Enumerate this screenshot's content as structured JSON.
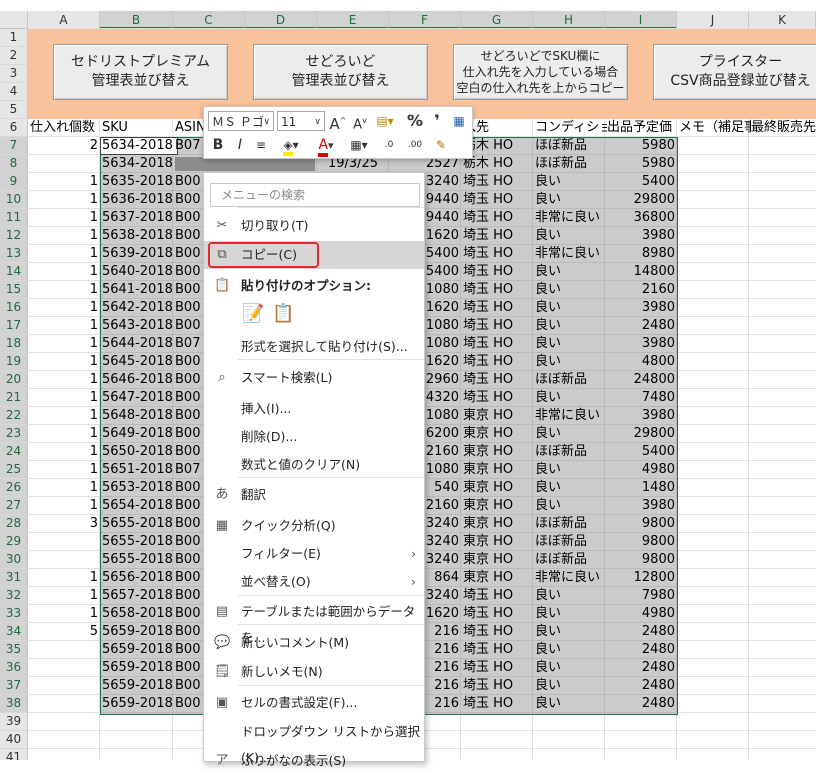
{
  "app": "Microsoft Excel",
  "columns": [
    "A",
    "B",
    "C",
    "D",
    "E",
    "F",
    "G",
    "H",
    "I",
    "J",
    "K"
  ],
  "rows": [
    "1",
    "2",
    "3",
    "4",
    "5",
    "6",
    "7",
    "8",
    "9",
    "10",
    "11",
    "12",
    "13",
    "14",
    "15",
    "16",
    "17",
    "18",
    "19",
    "20",
    "21",
    "22",
    "23",
    "24",
    "25",
    "26",
    "27",
    "28",
    "29",
    "30",
    "31",
    "32",
    "33",
    "34",
    "35",
    "36",
    "37",
    "38",
    "39",
    "40",
    "41"
  ],
  "macro_buttons": [
    {
      "label": "セドリストプレミアム\n管理表並び替え"
    },
    {
      "label": "せどろいど\n管理表並び替え"
    },
    {
      "label": "せどろいどでSKU欄に\n仕入れ先を入力している場合\n空白の仕入れ先を上からコピー"
    },
    {
      "label": "プライスター\nCSV商品登録並び替え"
    }
  ],
  "headers": {
    "A": "仕入れ個数",
    "B": "SKU",
    "C": "ASIN",
    "G": "入先",
    "H": "コンディショ",
    "I": "出品予定価",
    "J": "メモ（補足事",
    "K": "最終販売先"
  },
  "table_rows": [
    {
      "a": "2",
      "sku": "5634-2018",
      "asin": "B07",
      "e": "",
      "f": "",
      "g": "栃木 HO",
      "h": "ほぼ新品",
      "i": "5980"
    },
    {
      "a": "",
      "sku": "5634-2018",
      "asin": "",
      "e": "19/3/25",
      "f": "2527",
      "g": "栃木 HO",
      "h": "ほぼ新品",
      "i": "5980"
    },
    {
      "a": "1",
      "sku": "5635-2018",
      "asin": "B00",
      "e": "",
      "f": "3240",
      "g": "埼玉 HO",
      "h": "良い",
      "i": "5400"
    },
    {
      "a": "1",
      "sku": "5636-2018",
      "asin": "B00",
      "e": "",
      "f": "9440",
      "g": "埼玉 HO",
      "h": "良い",
      "i": "29800"
    },
    {
      "a": "1",
      "sku": "5637-2018",
      "asin": "B00",
      "e": "",
      "f": "9440",
      "g": "埼玉 HO",
      "h": "非常に良い",
      "i": "36800"
    },
    {
      "a": "1",
      "sku": "5638-2018",
      "asin": "B00",
      "e": "",
      "f": "1620",
      "g": "埼玉 HO",
      "h": "良い",
      "i": "3980"
    },
    {
      "a": "1",
      "sku": "5639-2018",
      "asin": "B00",
      "e": "",
      "f": "5400",
      "g": "埼玉 HO",
      "h": "非常に良い",
      "i": "8980"
    },
    {
      "a": "1",
      "sku": "5640-2018",
      "asin": "B00",
      "e": "",
      "f": "5400",
      "g": "埼玉 HO",
      "h": "良い",
      "i": "14800"
    },
    {
      "a": "1",
      "sku": "5641-2018",
      "asin": "B00",
      "e": "",
      "f": "1080",
      "g": "埼玉 HO",
      "h": "良い",
      "i": "2160"
    },
    {
      "a": "1",
      "sku": "5642-2018",
      "asin": "B00",
      "e": "",
      "f": "1620",
      "g": "埼玉 HO",
      "h": "良い",
      "i": "3980"
    },
    {
      "a": "1",
      "sku": "5643-2018",
      "asin": "B00",
      "e": "",
      "f": "1080",
      "g": "埼玉 HO",
      "h": "良い",
      "i": "2480"
    },
    {
      "a": "1",
      "sku": "5644-2018",
      "asin": "B07",
      "e": "",
      "f": "1080",
      "g": "埼玉 HO",
      "h": "良い",
      "i": "3980"
    },
    {
      "a": "1",
      "sku": "5645-2018",
      "asin": "B00",
      "e": "",
      "f": "1620",
      "g": "埼玉 HO",
      "h": "良い",
      "i": "4800"
    },
    {
      "a": "1",
      "sku": "5646-2018",
      "asin": "B00",
      "e": "",
      "f": "2960",
      "g": "埼玉 HO",
      "h": "ほぼ新品",
      "i": "24800"
    },
    {
      "a": "1",
      "sku": "5647-2018",
      "asin": "B00",
      "e": "",
      "f": "4320",
      "g": "埼玉 HO",
      "h": "良い",
      "i": "7480"
    },
    {
      "a": "1",
      "sku": "5648-2018",
      "asin": "B00",
      "e": "",
      "f": "1080",
      "g": "東京 HO",
      "h": "非常に良い",
      "i": "3980"
    },
    {
      "a": "1",
      "sku": "5649-2018",
      "asin": "B00",
      "e": "",
      "f": "6200",
      "g": "東京 HO",
      "h": "良い",
      "i": "29800"
    },
    {
      "a": "1",
      "sku": "5650-2018",
      "asin": "B00",
      "e": "",
      "f": "2160",
      "g": "東京 HO",
      "h": "ほぼ新品",
      "i": "5400"
    },
    {
      "a": "1",
      "sku": "5651-2018",
      "asin": "B07",
      "e": "",
      "f": "1080",
      "g": "東京 HO",
      "h": "良い",
      "i": "4980"
    },
    {
      "a": "1",
      "sku": "5653-2018",
      "asin": "B00",
      "e": "",
      "f": "540",
      "g": "東京 HO",
      "h": "良い",
      "i": "1480"
    },
    {
      "a": "1",
      "sku": "5654-2018",
      "asin": "B00",
      "e": "",
      "f": "2160",
      "g": "東京 HO",
      "h": "良い",
      "i": "3980"
    },
    {
      "a": "3",
      "sku": "5655-2018",
      "asin": "B00",
      "e": "",
      "f": "3240",
      "g": "東京 HO",
      "h": "ほぼ新品",
      "i": "9800"
    },
    {
      "a": "",
      "sku": "5655-2018",
      "asin": "B00",
      "e": "",
      "f": "3240",
      "g": "東京 HO",
      "h": "ほぼ新品",
      "i": "9800"
    },
    {
      "a": "",
      "sku": "5655-2018",
      "asin": "B00",
      "e": "",
      "f": "3240",
      "g": "東京 HO",
      "h": "ほぼ新品",
      "i": "9800"
    },
    {
      "a": "1",
      "sku": "5656-2018",
      "asin": "B00",
      "e": "",
      "f": "864",
      "g": "東京 HO",
      "h": "非常に良い",
      "i": "12800"
    },
    {
      "a": "1",
      "sku": "5657-2018",
      "asin": "B00",
      "e": "",
      "f": "3240",
      "g": "埼玉 HO",
      "h": "良い",
      "i": "7980"
    },
    {
      "a": "1",
      "sku": "5658-2018",
      "asin": "B00",
      "e": "",
      "f": "1620",
      "g": "埼玉 HO",
      "h": "良い",
      "i": "4980"
    },
    {
      "a": "5",
      "sku": "5659-2018",
      "asin": "B00",
      "e": "",
      "f": "216",
      "g": "埼玉 HO",
      "h": "良い",
      "i": "2480"
    },
    {
      "a": "",
      "sku": "5659-2018",
      "asin": "B00",
      "e": "",
      "f": "216",
      "g": "埼玉 HO",
      "h": "良い",
      "i": "2480"
    },
    {
      "a": "",
      "sku": "5659-2018",
      "asin": "B00",
      "e": "",
      "f": "216",
      "g": "埼玉 HO",
      "h": "良い",
      "i": "2480"
    },
    {
      "a": "",
      "sku": "5659-2018",
      "asin": "B00",
      "e": "",
      "f": "216",
      "g": "埼玉 HO",
      "h": "良い",
      "i": "2480"
    },
    {
      "a": "",
      "sku": "5659-2018",
      "asin": "B00",
      "e": "",
      "f": "216",
      "g": "埼玉 HO",
      "h": "良い",
      "i": "2480"
    }
  ],
  "toolbar": {
    "font_name": "ＭＳ Ｐゴ",
    "font_size": "11",
    "grow_font": "A",
    "shrink_font": "A",
    "percent": "%",
    "comma": "❜",
    "bold": "B",
    "italic": "I",
    "font_color": "A",
    "inc_decimal": ".0",
    "dec_decimal": ".00"
  },
  "context_menu": {
    "search_placeholder": "メニューの検索",
    "items": [
      {
        "label": "切り取り(T)",
        "icon": "scissors-icon"
      },
      {
        "label": "コピー(C)",
        "icon": "copy-icon"
      },
      {
        "label": "貼り付けのオプション:",
        "icon": "paste-icon"
      },
      {
        "label": "形式を選択して貼り付け(S)...",
        "icon": ""
      },
      {
        "label": "スマート検索(L)",
        "icon": "search-icon"
      },
      {
        "label": "挿入(I)...",
        "icon": ""
      },
      {
        "label": "削除(D)...",
        "icon": ""
      },
      {
        "label": "数式と値のクリア(N)",
        "icon": ""
      },
      {
        "label": "翻訳",
        "icon": "translate-icon"
      },
      {
        "label": "クイック分析(Q)",
        "icon": "quick-analysis-icon"
      },
      {
        "label": "フィルター(E)",
        "icon": ""
      },
      {
        "label": "並べ替え(O)",
        "icon": ""
      },
      {
        "label": "テーブルまたは範囲からデータを...",
        "icon": "table-icon"
      },
      {
        "label": "新しいコメント(M)",
        "icon": "comment-icon"
      },
      {
        "label": "新しいメモ(N)",
        "icon": "note-icon"
      },
      {
        "label": "セルの書式設定(F)...",
        "icon": "format-cells-icon"
      },
      {
        "label": "ドロップダウン リストから選択(K)...",
        "icon": ""
      },
      {
        "label": "ふりがなの表示(S)",
        "icon": "furigana-icon"
      }
    ]
  }
}
